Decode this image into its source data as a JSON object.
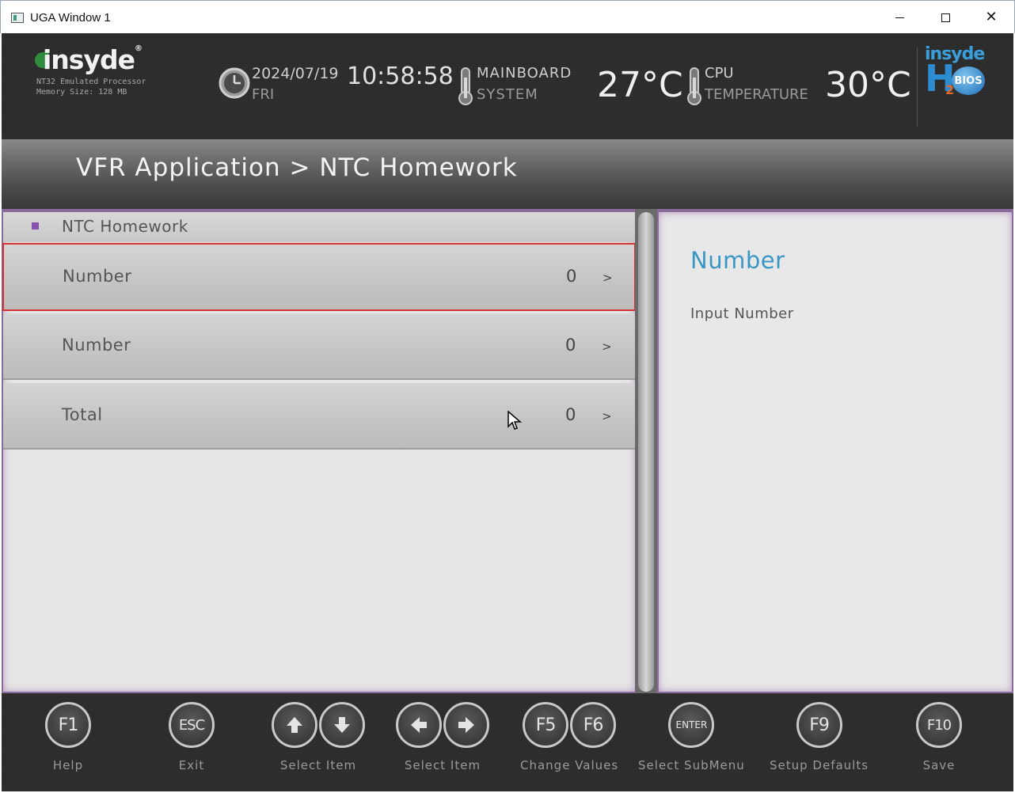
{
  "window": {
    "title": "UGA Window 1",
    "min_glyph": "",
    "max_glyph": "",
    "close_glyph": "✕"
  },
  "header": {
    "logo_text": "insyde",
    "logo_reg": "®",
    "processor": "NT32 Emulated Processor",
    "memory": "Memory Size: 128 MB",
    "date": "2024/07/19",
    "day": "FRI",
    "time": "10:58:58",
    "mainboard_label_top": "MAINBOARD",
    "mainboard_label_bottom": "SYSTEM",
    "mainboard_temp": "27°C",
    "cpu_label_top": "CPU",
    "cpu_label_bottom": "TEMPERATURE",
    "cpu_temp": "30°C",
    "h2o": {
      "insyde": "insyde",
      "h": "H",
      "two": "2",
      "bios": "BIOS"
    }
  },
  "breadcrumb": "VFR Application > NTC Homework",
  "menu": {
    "section_title": "NTC Homework",
    "items": [
      {
        "label": "Number",
        "value": "0",
        "arrow": ">",
        "selected": true
      },
      {
        "label": "Number",
        "value": "0",
        "arrow": ">",
        "selected": false
      },
      {
        "label": "Total",
        "value": "0",
        "arrow": ">",
        "selected": false
      }
    ]
  },
  "help": {
    "title": "Number",
    "text": "Input Number"
  },
  "footer": {
    "keys": [
      {
        "keys": [
          "F1"
        ],
        "label": "Help"
      },
      {
        "keys": [
          "ESC"
        ],
        "label": "Exit"
      },
      {
        "keys": [
          "up-arrow",
          "down-arrow"
        ],
        "label": "Select Item"
      },
      {
        "keys": [
          "left-arrow",
          "right-arrow"
        ],
        "label": "Select Item"
      },
      {
        "keys": [
          "F5",
          "F6"
        ],
        "label": "Change Values"
      },
      {
        "keys": [
          "ENTER"
        ],
        "label": "Select  SubMenu"
      },
      {
        "keys": [
          "F9"
        ],
        "label": "Setup Defaults"
      },
      {
        "keys": [
          "F10"
        ],
        "label": "Save"
      }
    ],
    "key_text": {
      "f1": "F1",
      "esc": "ESC",
      "f5": "F5",
      "f6": "F6",
      "enter": "ENTER",
      "f9": "F9",
      "f10": "F10"
    }
  },
  "colors": {
    "accent_purple": "#8a52b0",
    "help_title_blue": "#3a96c4",
    "selection_border": "#d33333"
  }
}
